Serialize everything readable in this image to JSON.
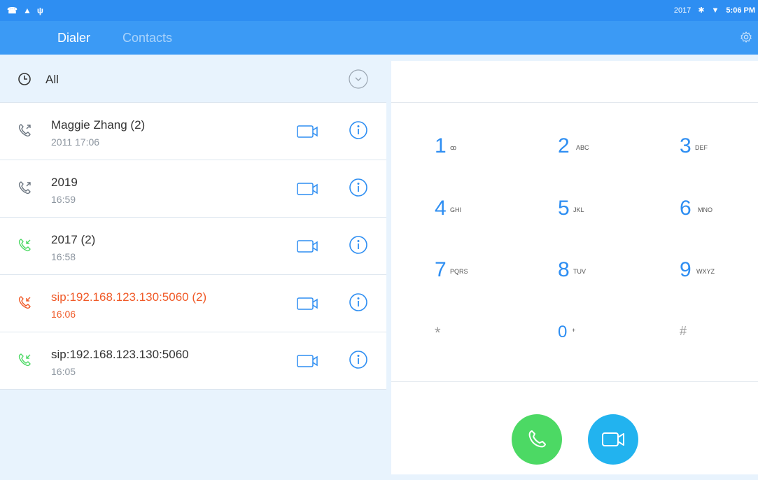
{
  "status_bar": {
    "left_icons": [
      "sim-icon",
      "warning-icon",
      "usb-icon"
    ],
    "right_text": "2017",
    "time": "5:06 PM"
  },
  "tabs": [
    {
      "label": "Dialer",
      "active": true
    },
    {
      "label": "Contacts",
      "active": false
    }
  ],
  "filter": {
    "label": "All"
  },
  "calls": [
    {
      "name": "Maggie Zhang (2)",
      "time": "2011 17:06",
      "type": "outgoing"
    },
    {
      "name": "2019",
      "time": "16:59",
      "type": "outgoing"
    },
    {
      "name": "2017 (2)",
      "time": "16:58",
      "type": "incoming"
    },
    {
      "name": "sip:192.168.123.130:5060 (2)",
      "time": "16:06",
      "type": "missed"
    },
    {
      "name": "sip:192.168.123.130:5060",
      "time": "16:05",
      "type": "incoming"
    }
  ],
  "keypad": [
    {
      "digit": "1",
      "letters": "ꝏ"
    },
    {
      "digit": "2",
      "letters": "ABC"
    },
    {
      "digit": "3",
      "letters": "DEF"
    },
    {
      "digit": "4",
      "letters": "GHI"
    },
    {
      "digit": "5",
      "letters": "JKL"
    },
    {
      "digit": "6",
      "letters": "MNO"
    },
    {
      "digit": "7",
      "letters": "PQRS"
    },
    {
      "digit": "8",
      "letters": "TUV"
    },
    {
      "digit": "9",
      "letters": "WXYZ"
    },
    {
      "digit": "*",
      "letters": ""
    },
    {
      "digit": "0",
      "letters": "+"
    },
    {
      "digit": "#",
      "letters": ""
    }
  ],
  "colors": {
    "accent": "#2e8ef2",
    "missed": "#f05a28",
    "incoming": "#4cd964",
    "outgoing": "#6b7580",
    "call_button": "#4cd964",
    "video_button": "#22b3ef"
  }
}
